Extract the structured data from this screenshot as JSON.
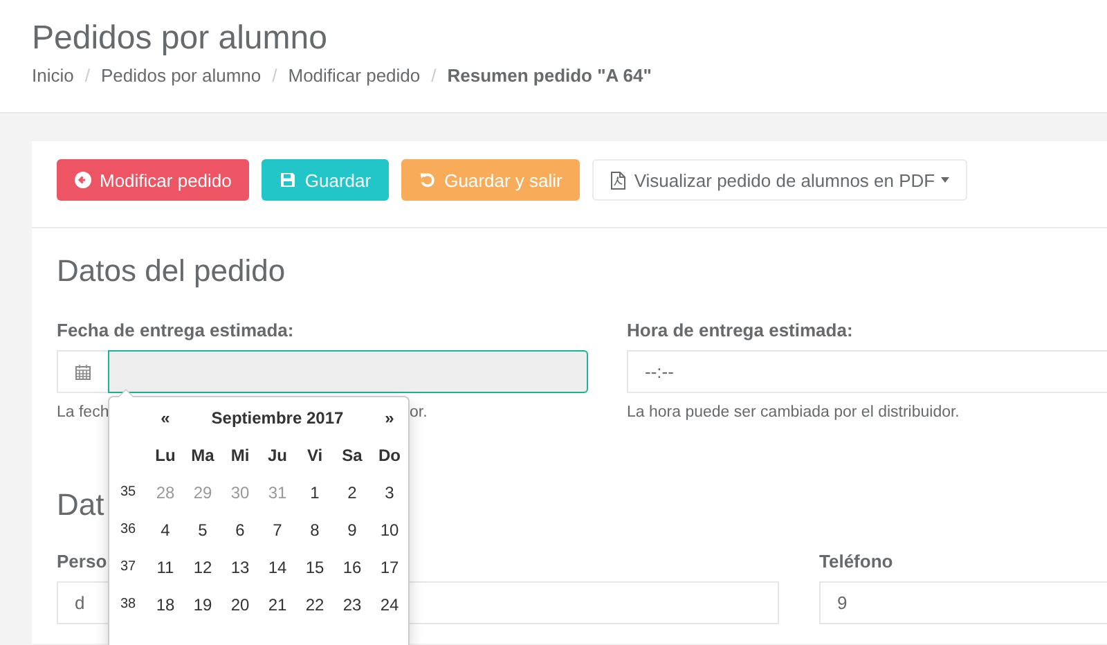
{
  "page_title": "Pedidos por alumno",
  "breadcrumb": [
    {
      "label": "Inicio",
      "current": false
    },
    {
      "separator": "/",
      "label": "Pedidos por alumno",
      "current": false
    },
    {
      "separator": "/",
      "label": "Modificar pedido",
      "current": false
    },
    {
      "separator": "/",
      "label": "Resumen pedido \"A 64\"",
      "current": true
    }
  ],
  "toolbar": [
    {
      "label": "Modificar pedido",
      "kind": "back"
    },
    {
      "label": "Guardar",
      "kind": "save"
    },
    {
      "label": "Guardar y salir",
      "kind": "save-exit"
    },
    {
      "label": "Visualizar pedido de alumnos en PDF",
      "kind": "pdf-menu"
    }
  ],
  "section_1": {
    "heading": "Datos del pedido",
    "fields": [
      {
        "kind": "date",
        "label": "Fecha de entrega estimada:",
        "focused": true,
        "help_start": "La fech",
        "help_end": "or."
      },
      {
        "kind": "time",
        "label": "Hora de entrega estimada:",
        "focused": false,
        "placeholder": "--:--",
        "help": "La hora puede ser cambiada por el distribuidor."
      }
    ]
  },
  "section_2": {
    "heading": "Dat",
    "fields": [
      {
        "kind": "text",
        "label": "Perso",
        "value": "d"
      },
      {
        "kind": "text",
        "label": "Teléfono",
        "value": "9"
      }
    ]
  },
  "datepicker": {
    "prev": "«",
    "month": "Septiembre 2017",
    "next": "»",
    "weekdays": [
      "Lu",
      "Ma",
      "Mi",
      "Ju",
      "Vi",
      "Sa",
      "Do"
    ],
    "weeks": [
      {
        "number": "35",
        "days": [
          {
            "day": "28",
            "other_month": true
          },
          {
            "day": "29",
            "other_month": true
          },
          {
            "day": "30",
            "other_month": true
          },
          {
            "day": "31",
            "other_month": true
          },
          {
            "day": "1",
            "other_month": false
          },
          {
            "day": "2",
            "other_month": false
          },
          {
            "day": "3",
            "other_month": false
          }
        ]
      },
      {
        "number": "36",
        "days": [
          {
            "day": "4",
            "other_month": false
          },
          {
            "day": "5",
            "other_month": false
          },
          {
            "day": "6",
            "other_month": false
          },
          {
            "day": "7",
            "other_month": false
          },
          {
            "day": "8",
            "other_month": false
          },
          {
            "day": "9",
            "other_month": false
          },
          {
            "day": "10",
            "other_month": false
          }
        ]
      },
      {
        "number": "37",
        "days": [
          {
            "day": "11",
            "other_month": false
          },
          {
            "day": "12",
            "other_month": false
          },
          {
            "day": "13",
            "other_month": false
          },
          {
            "day": "14",
            "other_month": false
          },
          {
            "day": "15",
            "other_month": false
          },
          {
            "day": "16",
            "other_month": false
          },
          {
            "day": "17",
            "other_month": false
          }
        ]
      },
      {
        "number": "38",
        "days": [
          {
            "day": "18",
            "other_month": false
          },
          {
            "day": "19",
            "other_month": false
          },
          {
            "day": "20",
            "other_month": false
          },
          {
            "day": "21",
            "other_month": false
          },
          {
            "day": "22",
            "other_month": false
          },
          {
            "day": "23",
            "other_month": false
          },
          {
            "day": "24",
            "other_month": false
          }
        ]
      }
    ]
  }
}
